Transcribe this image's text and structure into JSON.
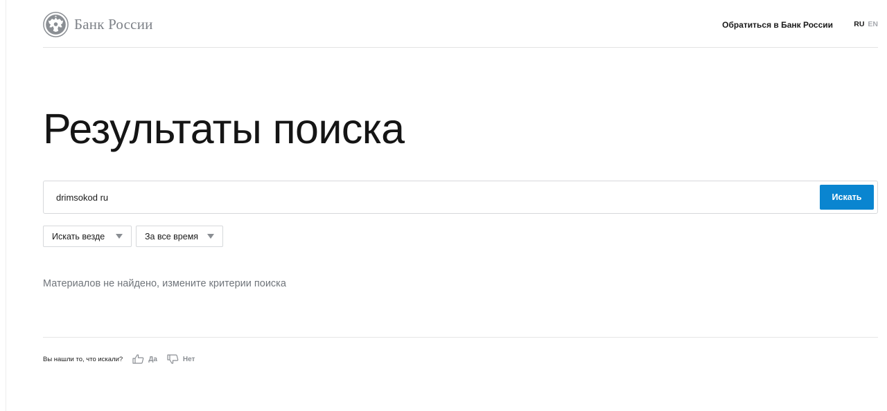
{
  "header": {
    "logo_text": "Банк России",
    "contact_link": "Обратиться в Банк России",
    "lang_ru": "RU",
    "lang_en": "EN"
  },
  "main": {
    "title": "Результаты поиска",
    "search": {
      "value": "drimsokod ru",
      "button_label": "Искать"
    },
    "filters": [
      {
        "label": "Искать везде"
      },
      {
        "label": "За все время"
      }
    ],
    "empty_message": "Материалов не найдено, измените критерии поиска"
  },
  "feedback": {
    "question": "Вы нашли то, что искали?",
    "yes_label": "Да",
    "no_label": "Нет"
  },
  "colors": {
    "accent": "#0a85d0",
    "muted_text": "#6f747a",
    "logo_gray": "#7d8187"
  },
  "icons": [
    "bank-emblem-icon",
    "chevron-down-icon",
    "thumbs-up-icon",
    "thumbs-down-icon"
  ]
}
